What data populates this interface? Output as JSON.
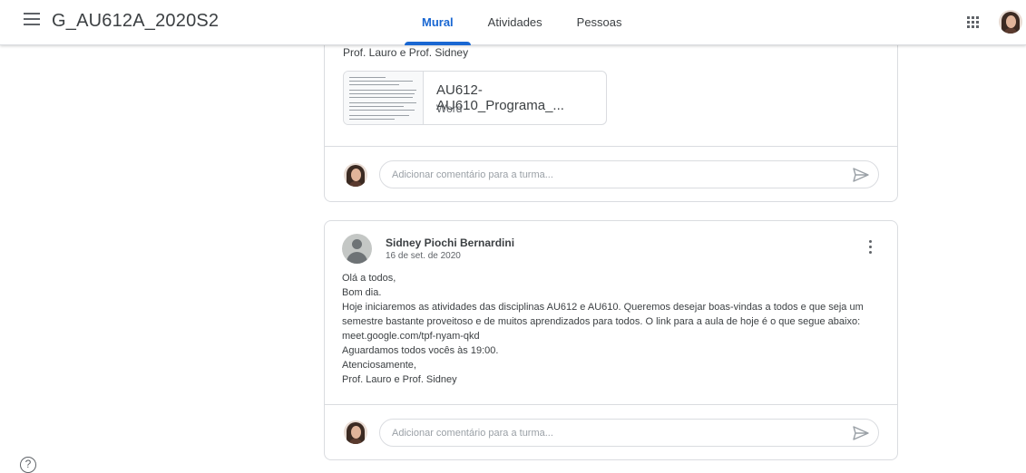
{
  "header": {
    "class_title": "G_AU612A_2020S2",
    "tabs": [
      {
        "label": "Mural",
        "active": true
      },
      {
        "label": "Atividades",
        "active": false
      },
      {
        "label": "Pessoas",
        "active": false
      }
    ],
    "accent_color": "#1967d2"
  },
  "posts": [
    {
      "signature_tail": "Prof. Lauro e Prof. Sidney",
      "attachment": {
        "name": "AU612-AU610_Programa_...",
        "type": "Word",
        "icon": "document-thumbnail"
      },
      "comment": {
        "placeholder": "Adicionar comentário para a turma..."
      }
    },
    {
      "author": "Sidney Piochi Bernardini",
      "date": "16 de set. de 2020",
      "body_lines": [
        "Olá a todos,",
        "Bom dia.",
        "Hoje iniciaremos as atividades das disciplinas AU612 e AU610. Queremos desejar boas-vindas a todos e que seja um",
        "semestre bastante proveitoso e de muitos aprendizados para todos. O link para a aula de hoje é o que segue abaixo:",
        "meet.google.com/tpf-nyam-qkd",
        "Aguardamos todos vocês às 19:00.",
        "Atenciosamente,",
        "Prof. Lauro e Prof. Sidney"
      ],
      "comment": {
        "placeholder": "Adicionar comentário para a turma..."
      }
    }
  ],
  "help": {
    "glyph": "?"
  }
}
